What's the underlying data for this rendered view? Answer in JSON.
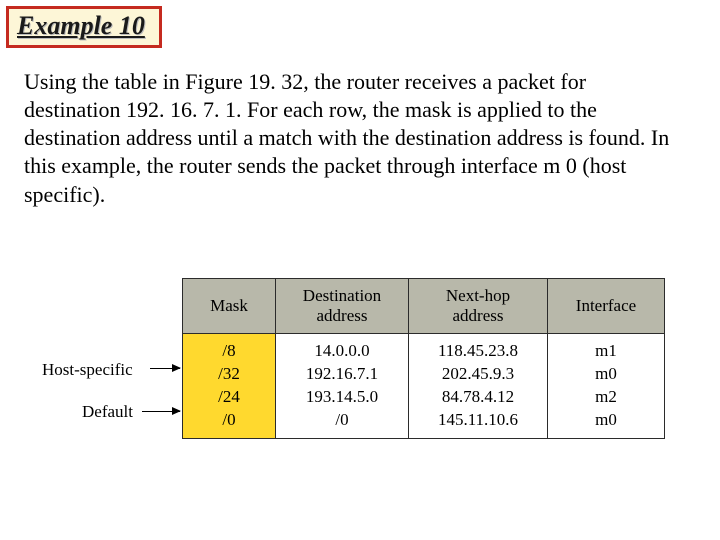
{
  "title": "Example 10",
  "paragraph": "Using the table in Figure 19. 32, the router receives a packet for destination 192. 16. 7. 1. For each row, the mask is applied to the destination address until a match with the destination address is found. In this example, the router sends the packet through interface m 0 (host specific).",
  "table": {
    "headers": {
      "mask": "Mask",
      "dest": "Destination address",
      "nhop": "Next-hop address",
      "iface": "Interface"
    },
    "rows": [
      {
        "mask": "/8",
        "dest": "14.0.0.0",
        "nhop": "118.45.23.8",
        "iface": "m1"
      },
      {
        "mask": "/32",
        "dest": "192.16.7.1",
        "nhop": "202.45.9.3",
        "iface": "m0"
      },
      {
        "mask": "/24",
        "dest": "193.14.5.0",
        "nhop": "84.78.4.12",
        "iface": "m2"
      },
      {
        "mask": "/0",
        "dest": "/0",
        "nhop": "145.11.10.6",
        "iface": "m0"
      }
    ]
  },
  "annotations": {
    "host_specific": "Host-specific",
    "default": "Default"
  }
}
